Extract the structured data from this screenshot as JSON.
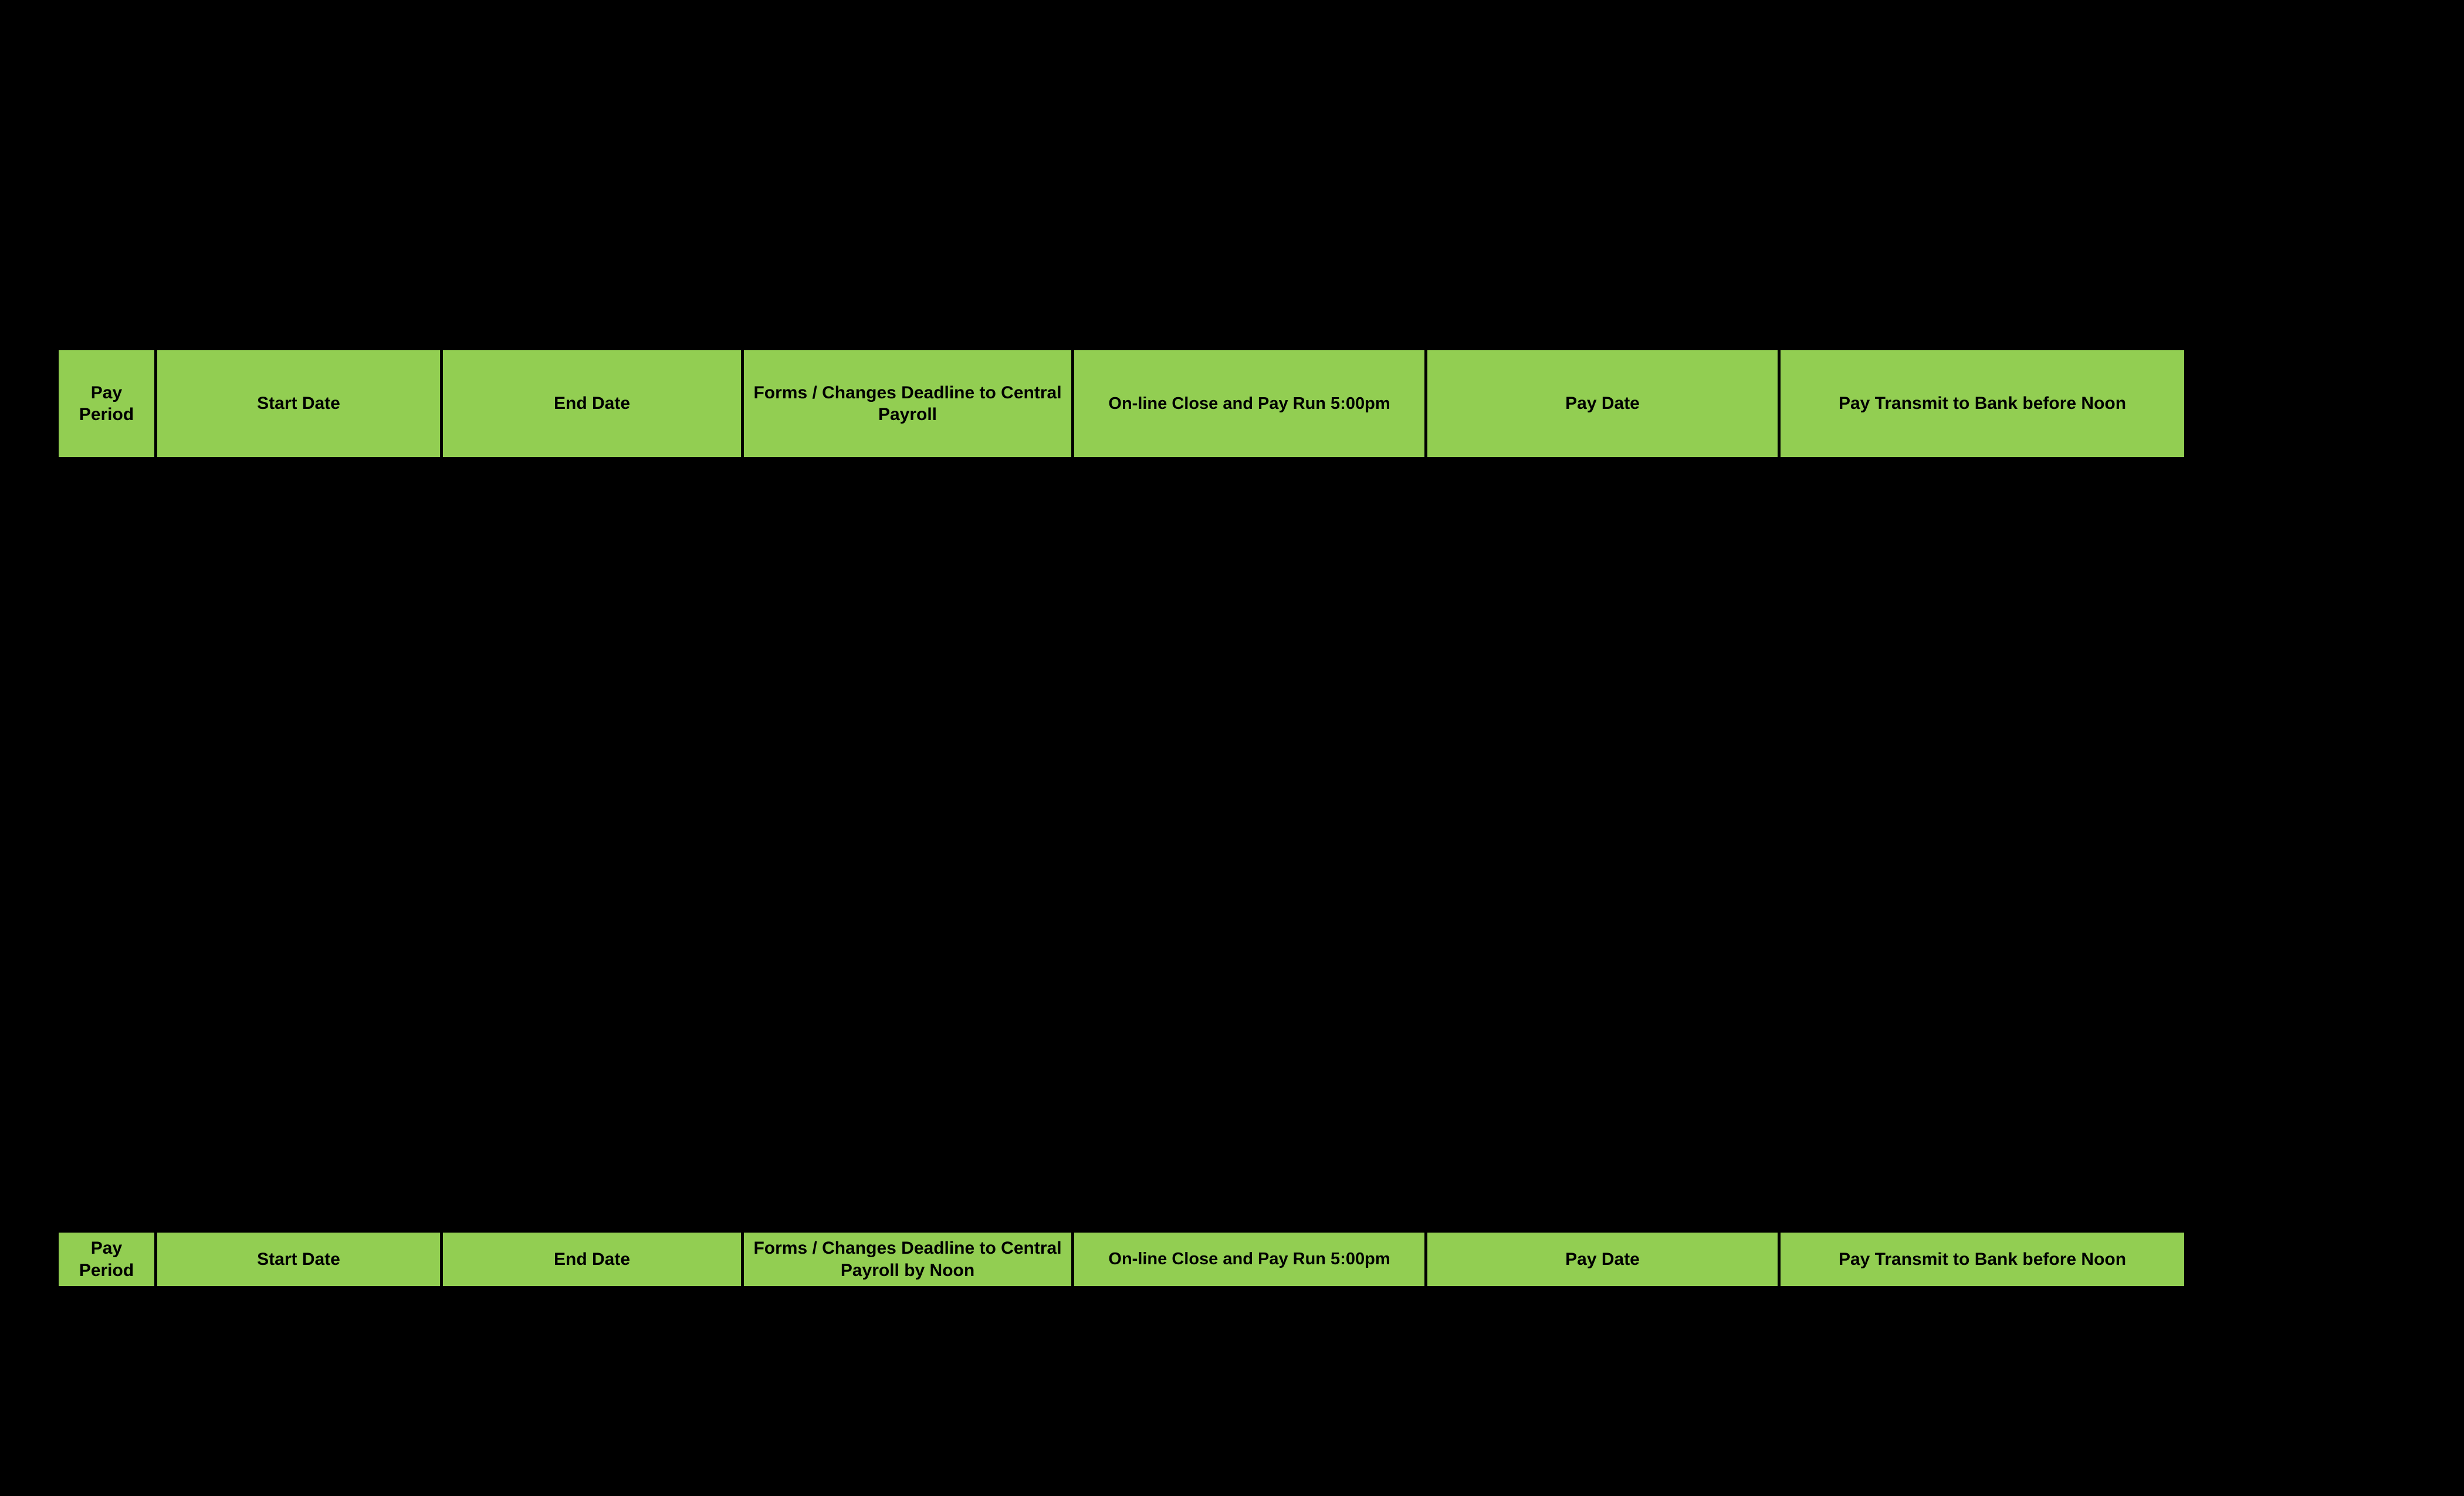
{
  "page": {
    "background_color": "#000000",
    "accent_color": "#92CE52",
    "text_color": "#000000"
  },
  "tables": [
    {
      "name": "payroll-header-table-top",
      "columns": [
        {
          "key": "pay_period",
          "label": "Pay\nPeriod"
        },
        {
          "key": "start_date",
          "label": "Start Date"
        },
        {
          "key": "end_date",
          "label": "End Date"
        },
        {
          "key": "forms",
          "label": "Forms / Changes Deadline to Central Payroll"
        },
        {
          "key": "online_close",
          "label": "On-line Close and Pay Run 5:00pm"
        },
        {
          "key": "pay_date",
          "label": "Pay Date"
        },
        {
          "key": "transmit",
          "label": "Pay Transmit to Bank before Noon"
        }
      ]
    },
    {
      "name": "payroll-header-table-bottom",
      "columns": [
        {
          "key": "pay_period",
          "label": "Pay\nPeriod"
        },
        {
          "key": "start_date",
          "label": "Start Date"
        },
        {
          "key": "end_date",
          "label": "End Date"
        },
        {
          "key": "forms",
          "label": "Forms / Changes Deadline to Central Payroll by Noon"
        },
        {
          "key": "online_close",
          "label": "On-line Close and Pay Run 5:00pm"
        },
        {
          "key": "pay_date",
          "label": "Pay Date"
        },
        {
          "key": "transmit",
          "label": "Pay Transmit to Bank before Noon"
        }
      ]
    }
  ]
}
